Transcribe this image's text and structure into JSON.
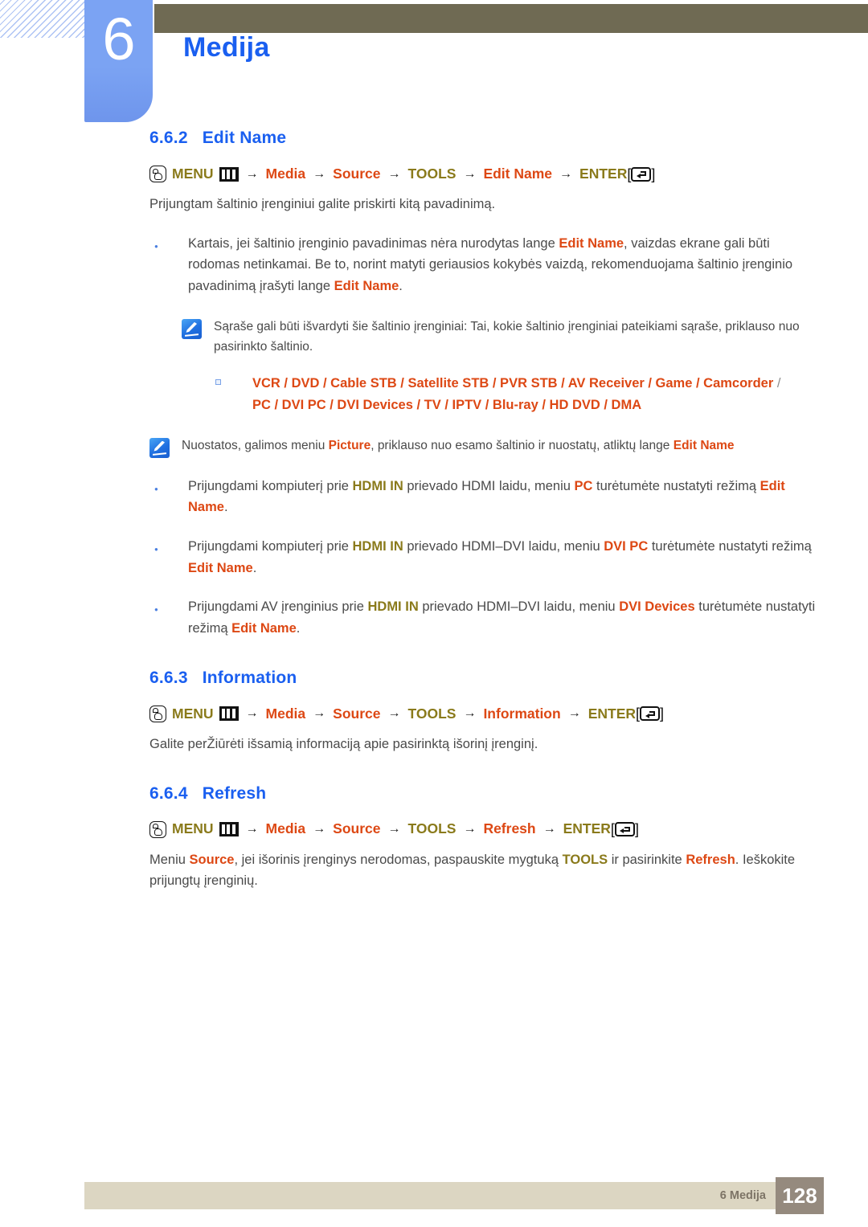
{
  "header": {
    "chapter_number": "6",
    "chapter_title": "Medija"
  },
  "sections": [
    {
      "num": "6.6.2",
      "title": "Edit Name",
      "navpath": {
        "menu_label": "MENU",
        "steps": [
          "Media",
          "Source",
          "TOOLS",
          "Edit Name"
        ],
        "enter_label": "ENTER",
        "bracket_open": "[",
        "bracket_close": "]",
        "arrow": "→"
      },
      "intro": "Prijungtam šaltinio įrenginiui galite priskirti kitą pavadinimą."
    },
    {
      "num": "6.6.3",
      "title": "Information",
      "navpath": {
        "menu_label": "MENU",
        "steps": [
          "Media",
          "Source",
          "TOOLS",
          "Information"
        ],
        "enter_label": "ENTER"
      },
      "intro": "Galite perŽiūrėti išsamią informaciją apie pasirinktą išorinį įrenginį."
    },
    {
      "num": "6.6.4",
      "title": "Refresh",
      "navpath": {
        "menu_label": "MENU",
        "steps": [
          "Media",
          "Source",
          "TOOLS",
          "Refresh"
        ],
        "enter_label": "ENTER"
      }
    }
  ],
  "bullets": {
    "b1_p1": "Kartais, jei šaltinio įrenginio pavadinimas nėra nurodytas lange ",
    "b1_em1": "Edit Name",
    "b1_p2": ", vaizdas ekrane gali būti rodomas netinkamai. Be to, norint matyti geriausios kokybės vaizdą, rekomenduojama šaltinio įrenginio pavadinimą įrašyti lange ",
    "b1_em2": "Edit Name",
    "b1_p3": ".",
    "b2_p1": "Prijungdami kompiuterį prie ",
    "b2_em1": "HDMI IN",
    "b2_p2": " prievado HDMI laidu, meniu ",
    "b2_em2": "PC",
    "b2_p3": " turėtumėte nustatyti režimą ",
    "b2_em3": "Edit Name",
    "b2_p4": ".",
    "b3_p1": "Prijungdami kompiuterį prie ",
    "b3_em1": "HDMI IN",
    "b3_p2": " prievado HDMI–DVI laidu, meniu ",
    "b3_em2": "DVI PC",
    "b3_p3": " turėtumėte nustatyti režimą ",
    "b3_em3": "Edit Name",
    "b3_p4": ".",
    "b4_p1": "Prijungdami AV įrenginius prie ",
    "b4_em1": "HDMI IN",
    "b4_p2": " prievado HDMI–DVI laidu, meniu ",
    "b4_em2": "DVI Devices",
    "b4_p3": " turėtumėte nustatyti režimą ",
    "b4_em3": "Edit Name",
    "b4_p4": "."
  },
  "notes": {
    "note1_text": "Sąraše gali būti išvardyti šie šaltinio įrenginiai: Tai, kokie šaltinio įrenginiai pateikiami sąraše, priklauso nuo pasirinkto šaltinio.",
    "note2_p1": "Nuostatos, galimos meniu ",
    "note2_em1": "Picture",
    "note2_p2": ", priklauso nuo esamo šaltinio ir nuostatų, atliktų lange ",
    "note2_em2": "Edit Name"
  },
  "device_list": {
    "line1": [
      "VCR",
      "DVD",
      "Cable STB",
      "Satellite STB",
      "PVR STB",
      "AV Receiver",
      "Game",
      "Camcorder"
    ],
    "line2": [
      "PC",
      "DVI PC",
      "DVI Devices",
      "TV",
      "IPTV",
      "Blu-ray",
      "HD DVD",
      "DMA"
    ],
    "separator": " / "
  },
  "refresh_paragraph": {
    "p1": "Meniu ",
    "em1": "Source",
    "p2": ", jei išorinis įrenginys nerodomas, paspauskite mygtuką ",
    "em2": "TOOLS",
    "p3": " ir pasirinkite ",
    "em3": "Refresh",
    "p4": ". Ieškokite prijungtų įrenginių."
  },
  "footer": {
    "label": "6 Medija",
    "page": "128"
  },
  "colors": {
    "heading_blue": "#1a5ff0",
    "orange": "#dd4814",
    "olive": "#8a7a1b",
    "olive_bar": "#6f6a53",
    "chapter_blue": "#7ba3f3",
    "footer_bar": "#dcd6c2",
    "footer_page_box": "#958a7e"
  }
}
